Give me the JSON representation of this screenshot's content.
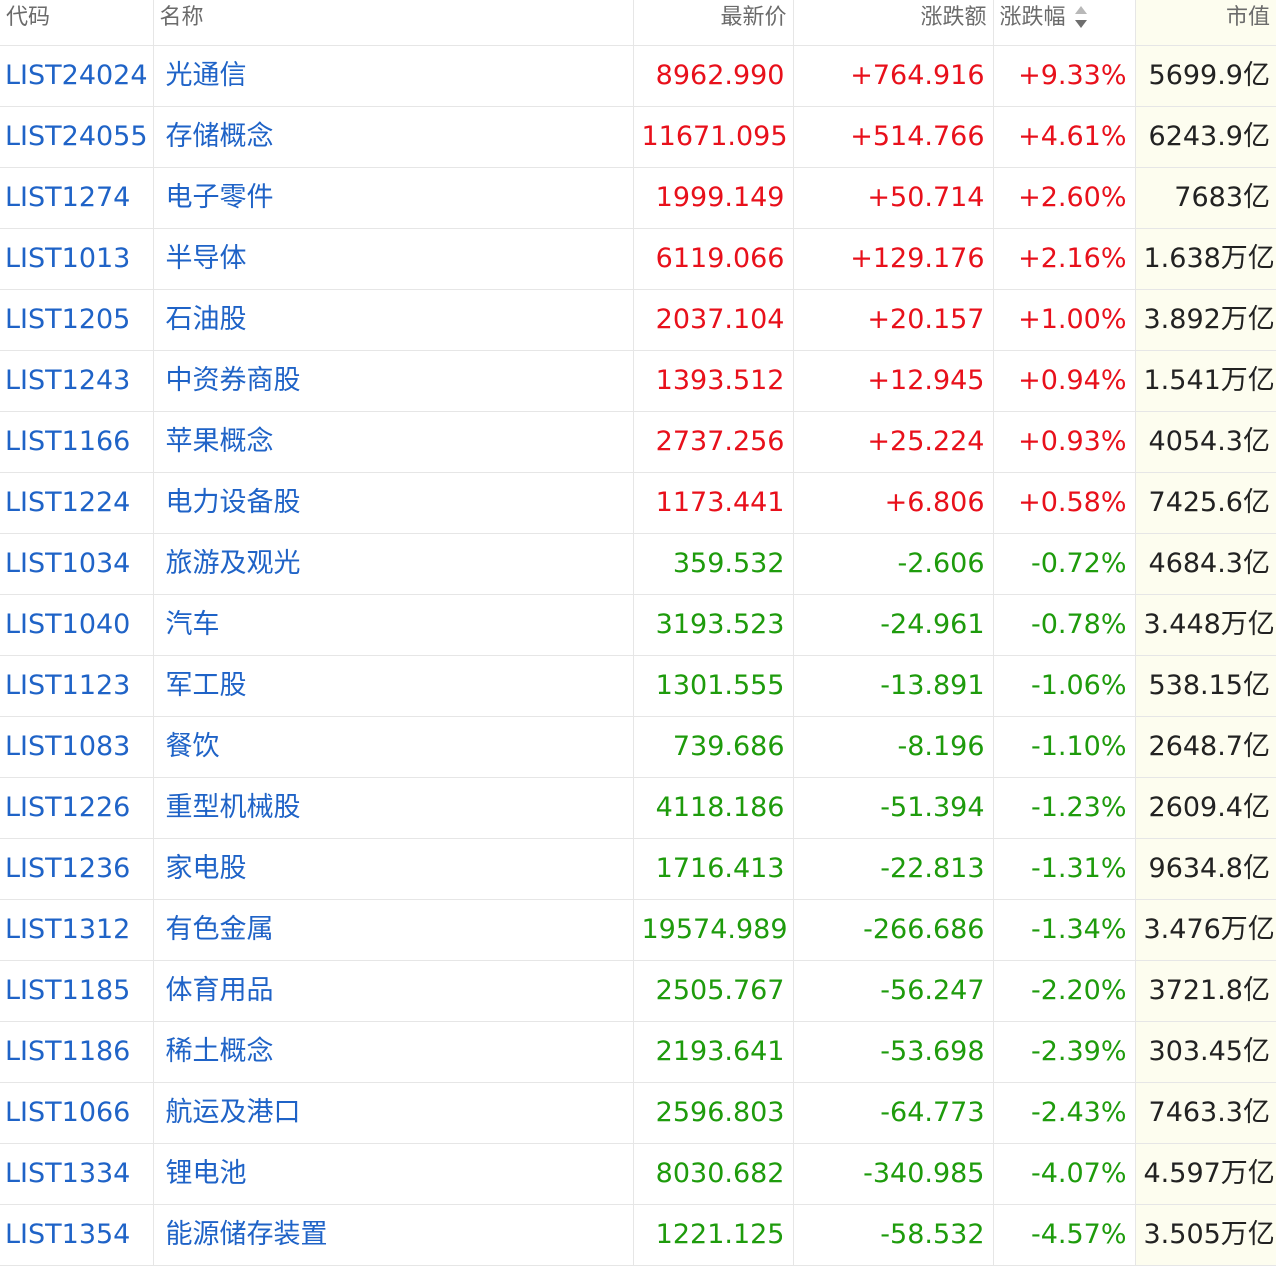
{
  "header": {
    "code": "代码",
    "name": "名称",
    "price": "最新价",
    "change": "涨跌额",
    "pct": "涨跌幅",
    "mcap": "市值"
  },
  "sort": {
    "column": "pct",
    "icon": "sort-updown-icon",
    "direction": "descending"
  },
  "colors": {
    "up": "#e8101b",
    "down": "#1e9b0c",
    "link": "#1f63c7"
  },
  "rows": [
    {
      "code": "LIST24024",
      "name": "光通信",
      "price": "8962.990",
      "change": "+764.916",
      "pct": "+9.33%",
      "mcap": "5699.9亿",
      "trend": "up"
    },
    {
      "code": "LIST24055",
      "name": "存储概念",
      "price": "11671.095",
      "change": "+514.766",
      "pct": "+4.61%",
      "mcap": "6243.9亿",
      "trend": "up"
    },
    {
      "code": "LIST1274",
      "name": "电子零件",
      "price": "1999.149",
      "change": "+50.714",
      "pct": "+2.60%",
      "mcap": "7683亿",
      "trend": "up"
    },
    {
      "code": "LIST1013",
      "name": "半导体",
      "price": "6119.066",
      "change": "+129.176",
      "pct": "+2.16%",
      "mcap": "1.638万亿",
      "trend": "up"
    },
    {
      "code": "LIST1205",
      "name": "石油股",
      "price": "2037.104",
      "change": "+20.157",
      "pct": "+1.00%",
      "mcap": "3.892万亿",
      "trend": "up"
    },
    {
      "code": "LIST1243",
      "name": "中资券商股",
      "price": "1393.512",
      "change": "+12.945",
      "pct": "+0.94%",
      "mcap": "1.541万亿",
      "trend": "up"
    },
    {
      "code": "LIST1166",
      "name": "苹果概念",
      "price": "2737.256",
      "change": "+25.224",
      "pct": "+0.93%",
      "mcap": "4054.3亿",
      "trend": "up"
    },
    {
      "code": "LIST1224",
      "name": "电力设备股",
      "price": "1173.441",
      "change": "+6.806",
      "pct": "+0.58%",
      "mcap": "7425.6亿",
      "trend": "up"
    },
    {
      "code": "LIST1034",
      "name": "旅游及观光",
      "price": "359.532",
      "change": "-2.606",
      "pct": "-0.72%",
      "mcap": "4684.3亿",
      "trend": "down"
    },
    {
      "code": "LIST1040",
      "name": "汽车",
      "price": "3193.523",
      "change": "-24.961",
      "pct": "-0.78%",
      "mcap": "3.448万亿",
      "trend": "down"
    },
    {
      "code": "LIST1123",
      "name": "军工股",
      "price": "1301.555",
      "change": "-13.891",
      "pct": "-1.06%",
      "mcap": "538.15亿",
      "trend": "down"
    },
    {
      "code": "LIST1083",
      "name": "餐饮",
      "price": "739.686",
      "change": "-8.196",
      "pct": "-1.10%",
      "mcap": "2648.7亿",
      "trend": "down"
    },
    {
      "code": "LIST1226",
      "name": "重型机械股",
      "price": "4118.186",
      "change": "-51.394",
      "pct": "-1.23%",
      "mcap": "2609.4亿",
      "trend": "down"
    },
    {
      "code": "LIST1236",
      "name": "家电股",
      "price": "1716.413",
      "change": "-22.813",
      "pct": "-1.31%",
      "mcap": "9634.8亿",
      "trend": "down"
    },
    {
      "code": "LIST1312",
      "name": "有色金属",
      "price": "19574.989",
      "change": "-266.686",
      "pct": "-1.34%",
      "mcap": "3.476万亿",
      "trend": "down"
    },
    {
      "code": "LIST1185",
      "name": "体育用品",
      "price": "2505.767",
      "change": "-56.247",
      "pct": "-2.20%",
      "mcap": "3721.8亿",
      "trend": "down"
    },
    {
      "code": "LIST1186",
      "name": "稀土概念",
      "price": "2193.641",
      "change": "-53.698",
      "pct": "-2.39%",
      "mcap": "303.45亿",
      "trend": "down"
    },
    {
      "code": "LIST1066",
      "name": "航运及港口",
      "price": "2596.803",
      "change": "-64.773",
      "pct": "-2.43%",
      "mcap": "7463.3亿",
      "trend": "down"
    },
    {
      "code": "LIST1334",
      "name": "锂电池",
      "price": "8030.682",
      "change": "-340.985",
      "pct": "-4.07%",
      "mcap": "4.597万亿",
      "trend": "down"
    },
    {
      "code": "LIST1354",
      "name": "能源储存装置",
      "price": "1221.125",
      "change": "-58.532",
      "pct": "-4.57%",
      "mcap": "3.505万亿",
      "trend": "down"
    }
  ]
}
